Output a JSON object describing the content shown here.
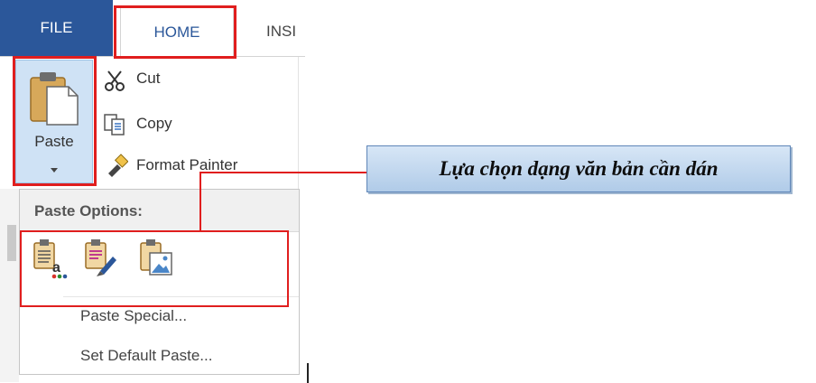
{
  "tabs": {
    "file": "FILE",
    "home": "HOME",
    "insert_partial": "INSI"
  },
  "clipboard": {
    "paste": "Paste",
    "cut": "Cut",
    "copy": "Copy",
    "format_painter": "Format Painter"
  },
  "paste_menu": {
    "header": "Paste Options:",
    "options_icons": [
      "keep-source-formatting-icon",
      "merge-formatting-icon",
      "picture-icon"
    ],
    "paste_special": "Paste Special...",
    "set_default": "Set Default Paste..."
  },
  "callout": {
    "text": "Lựa chọn dạng văn bản cần dán"
  },
  "colors": {
    "file_tab": "#2b579a",
    "highlight": "#e01e1e",
    "callout_fill": "#c5daf0"
  }
}
